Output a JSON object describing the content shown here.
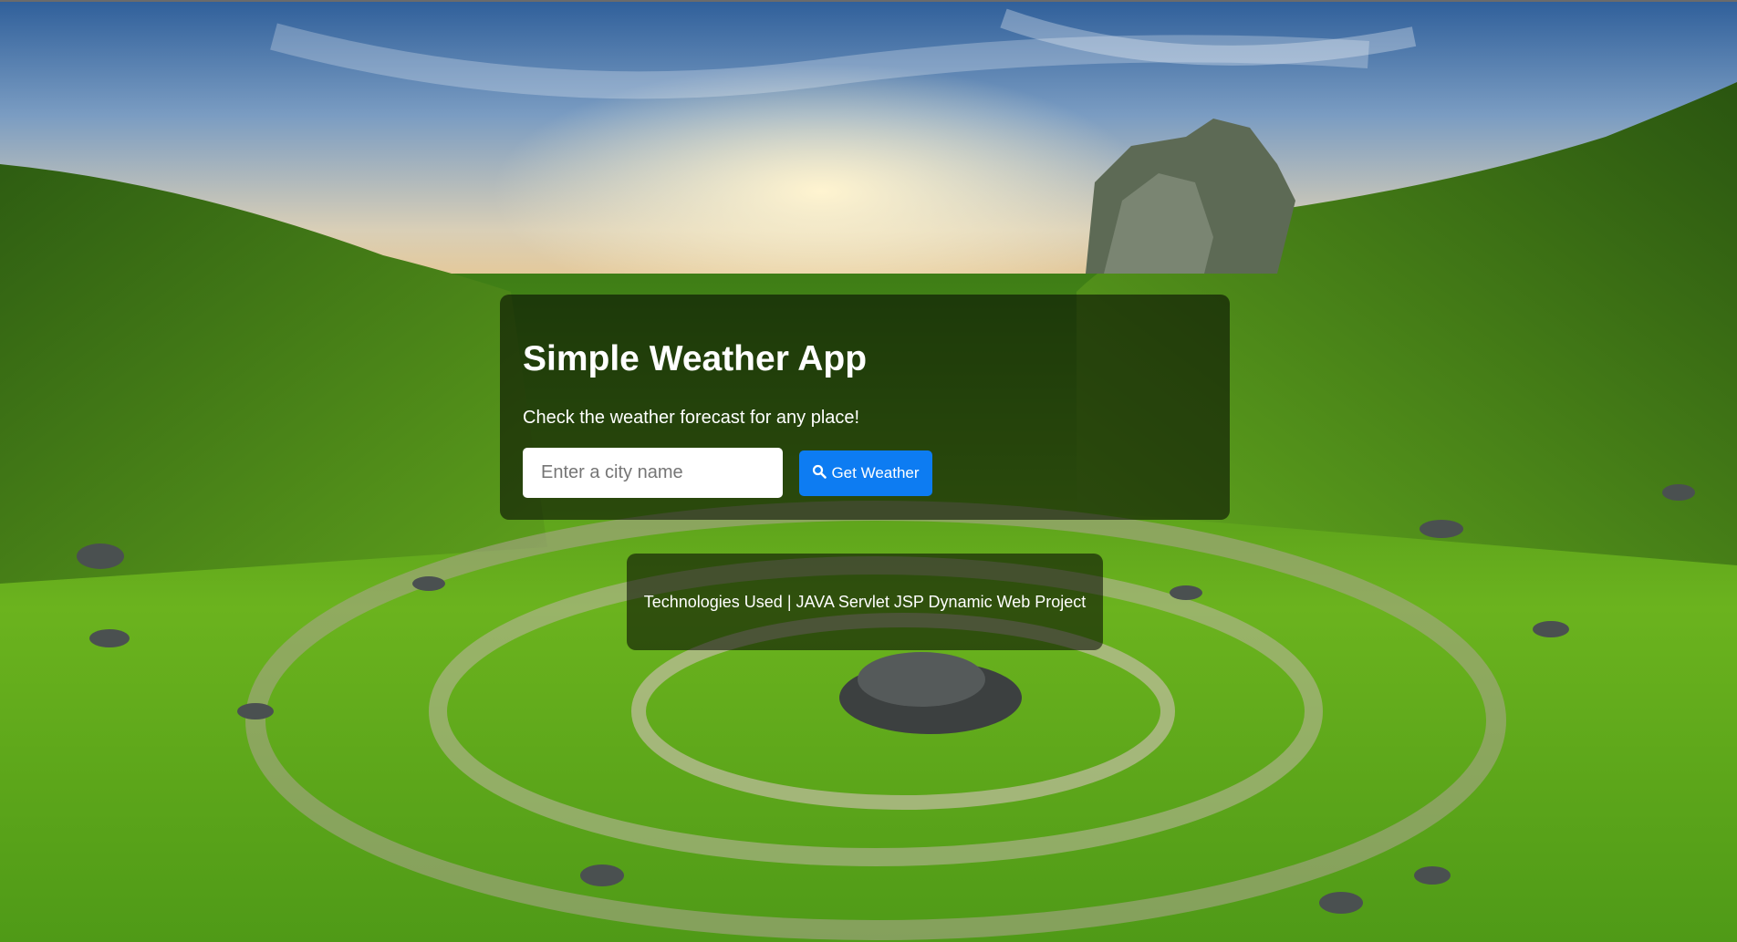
{
  "app": {
    "title": "Simple Weather App",
    "subtitle": "Check the weather forecast for any place!"
  },
  "search": {
    "placeholder": "Enter a city name",
    "value": "",
    "button_label": "Get Weather",
    "button_icon": "search-icon"
  },
  "footer": {
    "text": "Technologies Used | JAVA Servlet JSP Dynamic Web Project"
  },
  "colors": {
    "button": "#0d7cf2",
    "card_overlay": "rgba(0,0,0,0.55)",
    "text": "#ffffff"
  }
}
